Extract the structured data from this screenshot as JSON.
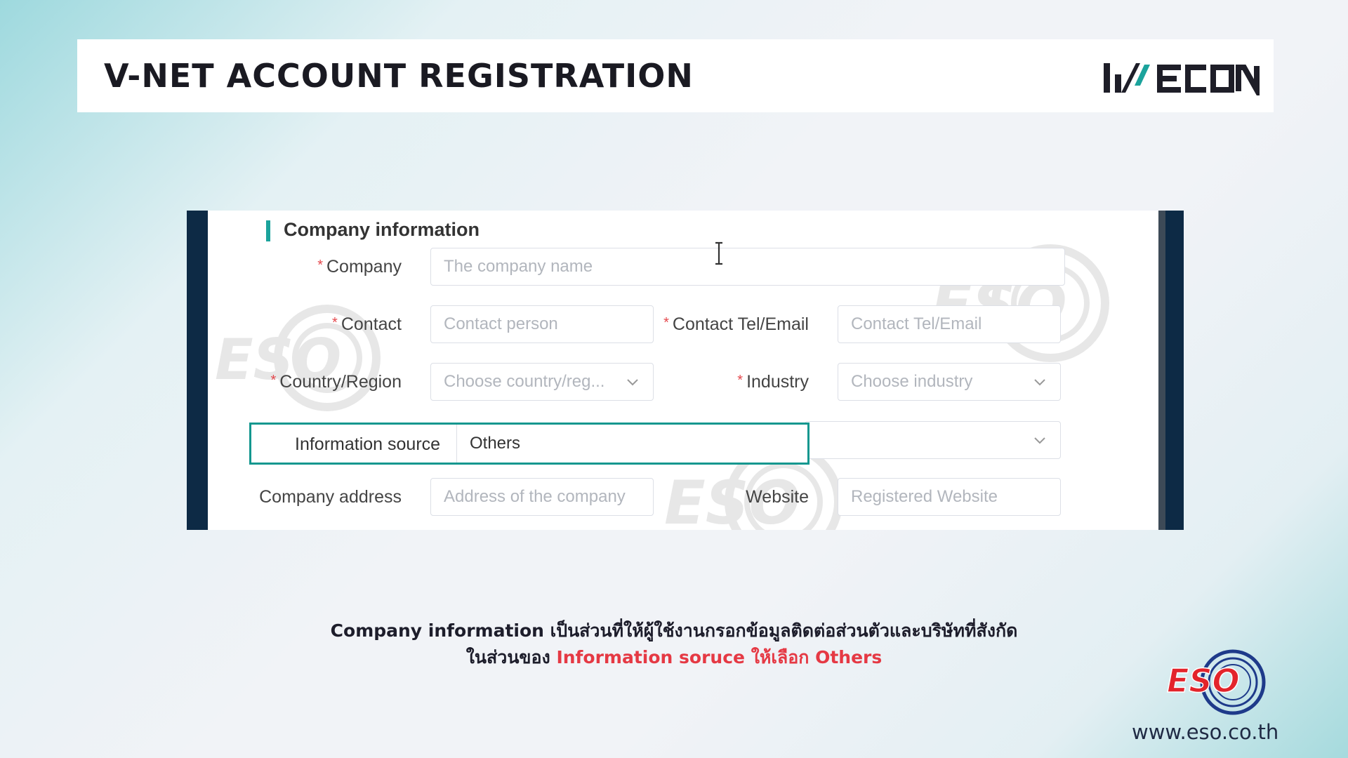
{
  "header": {
    "title": "V-NET ACCOUNT REGISTRATION",
    "brand_logo": "WECON"
  },
  "form": {
    "section_title": "Company information",
    "fields": {
      "company": {
        "label": "Company",
        "required": true,
        "placeholder": "The company name"
      },
      "contact": {
        "label": "Contact",
        "required": true,
        "placeholder": "Contact person"
      },
      "contact_tel_email": {
        "label": "Contact Tel/Email",
        "required": true,
        "placeholder": "Contact Tel/Email"
      },
      "country_region": {
        "label": "Country/Region",
        "required": true,
        "placeholder": "Choose country/reg..."
      },
      "industry": {
        "label": "Industry",
        "required": true,
        "placeholder": "Choose industry"
      },
      "information_source": {
        "label": "Information source",
        "required": false,
        "value": "Others"
      },
      "company_address": {
        "label": "Company address",
        "required": false,
        "placeholder": "Address of the company"
      },
      "website": {
        "label": "Website",
        "required": false,
        "placeholder": "Registered Website"
      }
    },
    "watermark": "ESO"
  },
  "caption": {
    "line1": "Company information เป็นส่วนที่ให้ผู้ใช้งานกรอกข้อมูลติดต่อส่วนตัวและบริษัทที่สังกัด",
    "line2_prefix": "ในส่วนของ",
    "line2_highlight": "Information soruce ให้เลือก Others"
  },
  "footer": {
    "logo_text": "ESO",
    "url": "www.eso.co.th"
  },
  "colors": {
    "accent_teal": "#14978f",
    "required_star": "#e5484d",
    "caption_highlight": "#e53944",
    "screenshot_frame": "#0d2a45",
    "eso_red": "#e3242b",
    "eso_blue": "#1e3a8a"
  },
  "icons": [
    "chevron-down-icon",
    "text-cursor-icon",
    "eso-watermark-icon"
  ]
}
